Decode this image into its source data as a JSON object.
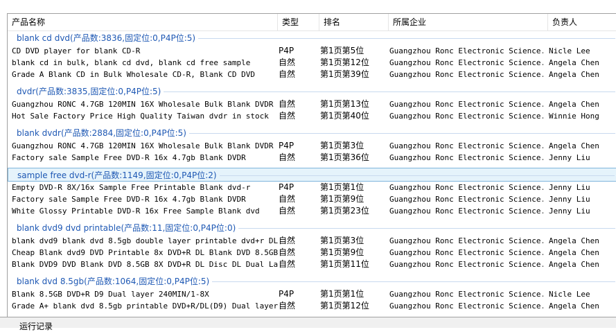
{
  "columns": [
    "产品名称",
    "类型",
    "排名",
    "所属企业",
    "负责人"
  ],
  "groups": [
    {
      "title": "blank cd dvd(产品数:3836,固定位:0,P4P位:5)",
      "selected": false,
      "rows": [
        [
          "CD DVD player for blank CD-R",
          "P4P",
          "第1页第5位",
          "Guangzhou Ronc Electronic Science...",
          "Nicle Lee"
        ],
        [
          "blank cd in bulk, blank cd dvd, blank cd free sample",
          "自然",
          "第1页第12位",
          "Guangzhou Ronc Electronic Science...",
          "Angela Chen"
        ],
        [
          "Grade A Blank CD in Bulk Wholesale CD-R, Blank CD DVD",
          "自然",
          "第1页第39位",
          "Guangzhou Ronc Electronic Science...",
          "Angela Chen"
        ]
      ]
    },
    {
      "title": "dvdr(产品数:3835,固定位:0,P4P位:5)",
      "selected": false,
      "rows": [
        [
          "Guangzhou RONC 4.7GB 120MIN 16X Wholesale Bulk Blank DVDR",
          "自然",
          "第1页第13位",
          "Guangzhou Ronc Electronic Science...",
          "Angela Chen"
        ],
        [
          "Hot Sale Factory Price High Quality Taiwan dvdr in stock",
          "自然",
          "第1页第40位",
          "Guangzhou Ronc Electronic Science...",
          "Winnie Hong"
        ]
      ]
    },
    {
      "title": "blank dvdr(产品数:2884,固定位:0,P4P位:5)",
      "selected": false,
      "rows": [
        [
          "Guangzhou RONC 4.7GB 120MIN 16X Wholesale Bulk Blank DVDR",
          "P4P",
          "第1页第3位",
          "Guangzhou Ronc Electronic Science...",
          "Angela Chen"
        ],
        [
          "Factory sale Sample Free DVD-R 16x 4.7gb Blank DVDR",
          "自然",
          "第1页第36位",
          "Guangzhou Ronc Electronic Science...",
          "Jenny Liu"
        ]
      ]
    },
    {
      "title": "sample free dvd-r(产品数:1149,固定位:0,P4P位:2)",
      "selected": true,
      "rows": [
        [
          "Empty DVD-R 8X/16x Sample Free Printable Blank dvd-r",
          "P4P",
          "第1页第1位",
          "Guangzhou Ronc Electronic Science...",
          "Jenny Liu"
        ],
        [
          "Factory sale Sample Free DVD-R 16x 4.7gb Blank DVDR",
          "自然",
          "第1页第9位",
          "Guangzhou Ronc Electronic Science...",
          "Jenny Liu"
        ],
        [
          "White Glossy Printable DVD-R 16x Free Sample Blank dvd",
          "自然",
          "第1页第23位",
          "Guangzhou Ronc Electronic Science...",
          "Jenny Liu"
        ]
      ]
    },
    {
      "title": "blank dvd9 dvd printable(产品数:11,固定位:0,P4P位:0)",
      "selected": false,
      "rows": [
        [
          "blank dvd9 blank dvd 8.5gb double layer printable dvd+r DL",
          "自然",
          "第1页第3位",
          "Guangzhou Ronc Electronic Science...",
          "Angela Chen"
        ],
        [
          "Cheap Blank dvd9 DVD Printable 8x DVD+R DL Blank DVD 8.5GB, ...",
          "自然",
          "第1页第9位",
          "Guangzhou Ronc Electronic Science...",
          "Angela Chen"
        ],
        [
          "Blank DVD9 DVD Blank DVD 8.5GB 8X DVD+R DL Disc DL Dual Laye...",
          "自然",
          "第1页第11位",
          "Guangzhou Ronc Electronic Science...",
          "Angela Chen"
        ]
      ]
    },
    {
      "title": "blank dvd 8.5gb(产品数:1064,固定位:0,P4P位:5)",
      "selected": false,
      "rows": [
        [
          "Blank 8.5GB DVD+R D9 Dual layer 240MIN/1-8X",
          "P4P",
          "第1页第1位",
          "Guangzhou Ronc Electronic Science...",
          "Nicle Lee"
        ],
        [
          "Grade A+ blank dvd 8.5gb printable DVD+R/DL(D9) Dual layer",
          "自然",
          "第1页第12位",
          "Guangzhou Ronc Electronic Science...",
          "Angela Chen"
        ]
      ]
    }
  ],
  "bottom_tab_label": "运行记录",
  "colors": {
    "group_title": "#1e58b4",
    "selection_bg": "#e5f3fb",
    "selection_border": "#7fb5dc"
  }
}
